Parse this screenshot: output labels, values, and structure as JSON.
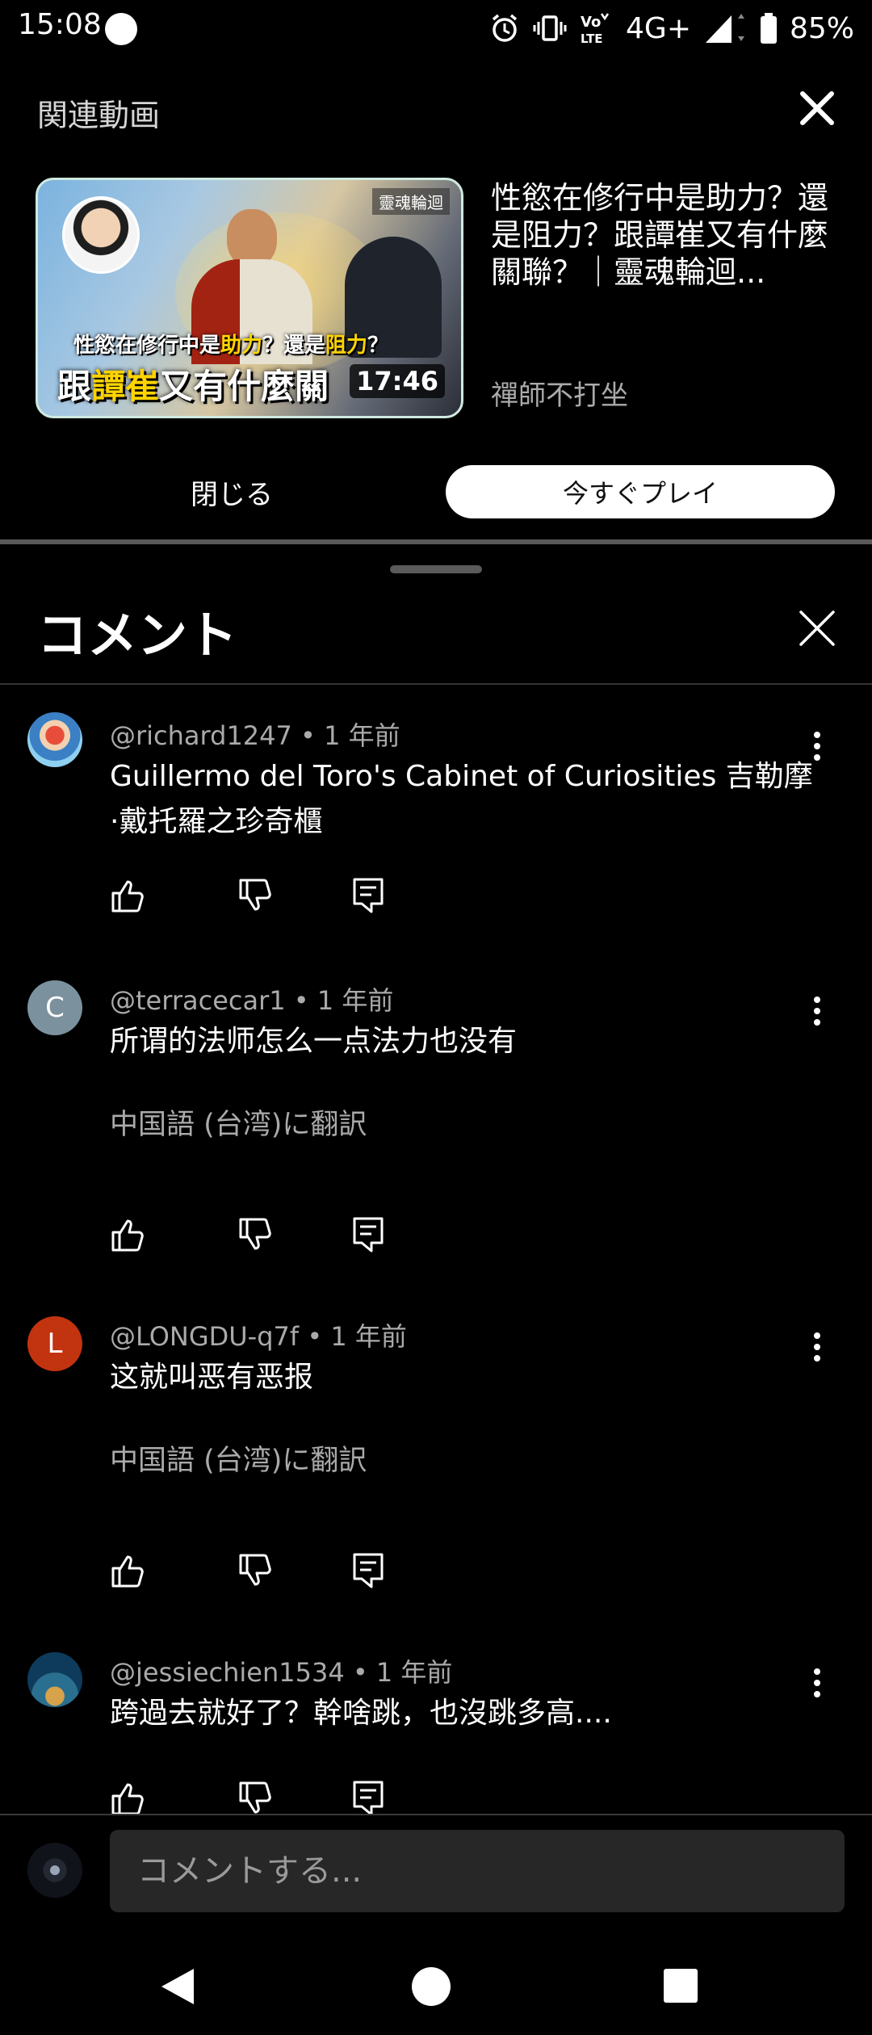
{
  "status_bar": {
    "time": "15:08",
    "battery": "85%",
    "network": "4G+"
  },
  "related": {
    "section_title": "関連動画",
    "thumbnail": {
      "badge": "靈魂輪迴",
      "caption_line1": [
        "性慾在修行中是",
        "助力",
        "？還是",
        "阻力",
        "？"
      ],
      "caption_line2": [
        "跟",
        "譚崔",
        "又有什麼關"
      ],
      "duration": "17:46"
    },
    "video_title": "性慾在修行中是助力？還是阻力？跟譚崔又有什麼關聯？｜靈魂輪迴...",
    "channel": "禪師不打坐",
    "close_button": "閉じる",
    "play_button": "今すぐプレイ"
  },
  "comments_sheet": {
    "title": "コメント",
    "comments": [
      {
        "author": "@richard1247",
        "age": "1 年前",
        "text": "Guillermo del Toro's Cabinet of Curiosities  吉勒摩·戴托羅之珍奇櫃",
        "translate": ""
      },
      {
        "author": "@terracecar1",
        "age": "1 年前",
        "text": "所谓的法师怎么一点法力也没有",
        "translate": "中国語 (台湾)に翻訳",
        "avatar_letter": "C"
      },
      {
        "author": "@LONGDU-q7f",
        "age": "1 年前",
        "text": "这就叫恶有恶报",
        "translate": "中国語 (台湾)に翻訳",
        "avatar_letter": "L"
      },
      {
        "author": "@jessiechien1534",
        "age": "1 年前",
        "text": "跨過去就好了？幹啥跳，也沒跳多高....",
        "translate": ""
      }
    ],
    "separator": " • ",
    "input_placeholder": "コメントする..."
  },
  "colors": {
    "background": "#000000",
    "secondary_text": "#aaaaaa",
    "avatar_c": "#7b929e",
    "avatar_l": "#c2330f",
    "play_button_bg": "#ffffff"
  },
  "icons": [
    "alarm-icon",
    "vibrate-icon",
    "volte-icon",
    "signal-icon",
    "battery-icon",
    "close-icon",
    "like-icon",
    "dislike-icon",
    "reply-icon",
    "more-vert-icon",
    "back-icon",
    "home-icon",
    "recents-icon"
  ]
}
